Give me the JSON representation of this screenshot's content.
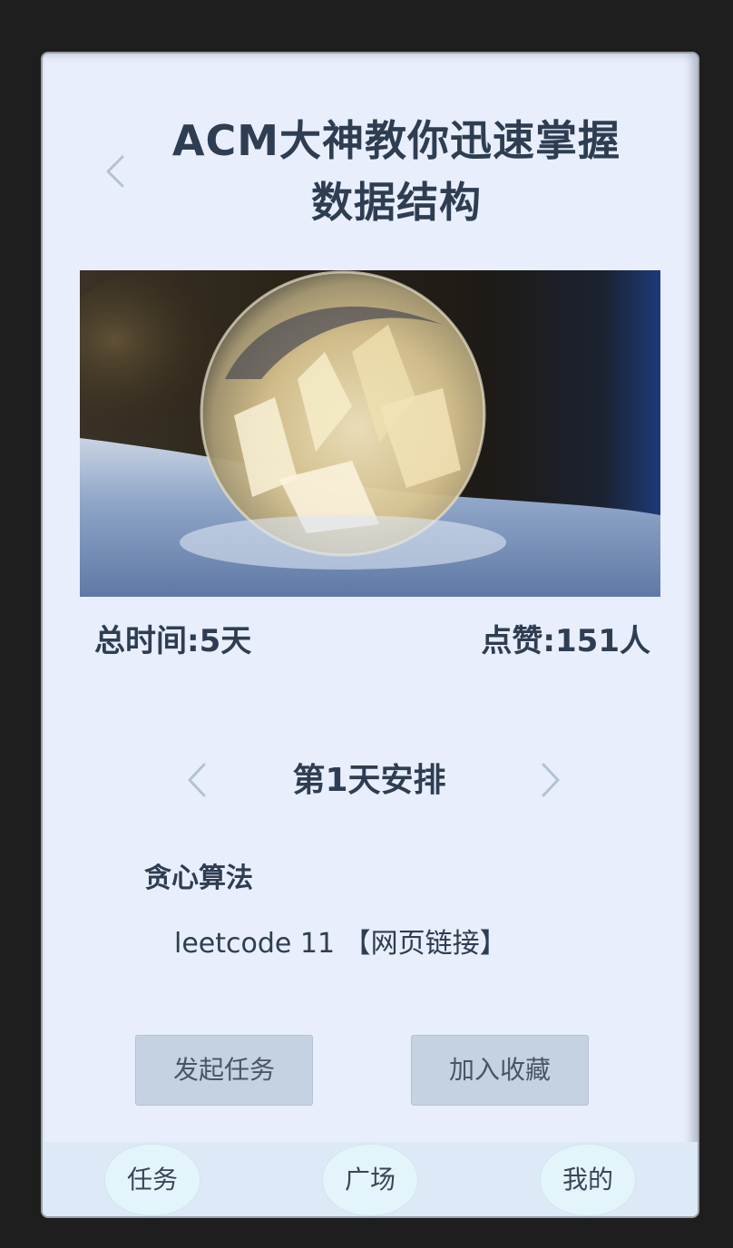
{
  "header": {
    "title_line1": "ACM大神教你迅速掌握",
    "title_line2": "数据结构",
    "back_icon": "chevron-left-icon"
  },
  "hero_image": {
    "subject": "frozen-bubble-on-snow"
  },
  "stats": {
    "total_time": "总时间:5天",
    "likes": "点赞:151人"
  },
  "schedule": {
    "day_title": "第1天安排",
    "prev_icon": "chevron-left-icon",
    "next_icon": "chevron-right-icon",
    "topic": "贪心算法",
    "task_text": "leetcode 11 ",
    "task_link": "【网页链接】"
  },
  "actions": {
    "start_task": "发起任务",
    "add_favorite": "加入收藏"
  },
  "tabbar": {
    "tabs": [
      {
        "label": "任务"
      },
      {
        "label": "广场"
      },
      {
        "label": "我的"
      }
    ]
  },
  "colors": {
    "page_bg": "#e8eefb",
    "text_primary": "#2e3d52",
    "button_bg": "#c5d2e2",
    "tabbar_bg": "#dde9f7",
    "tab_bubble_bg": "#e3f4fa",
    "chevron": "#b3c2d6"
  }
}
